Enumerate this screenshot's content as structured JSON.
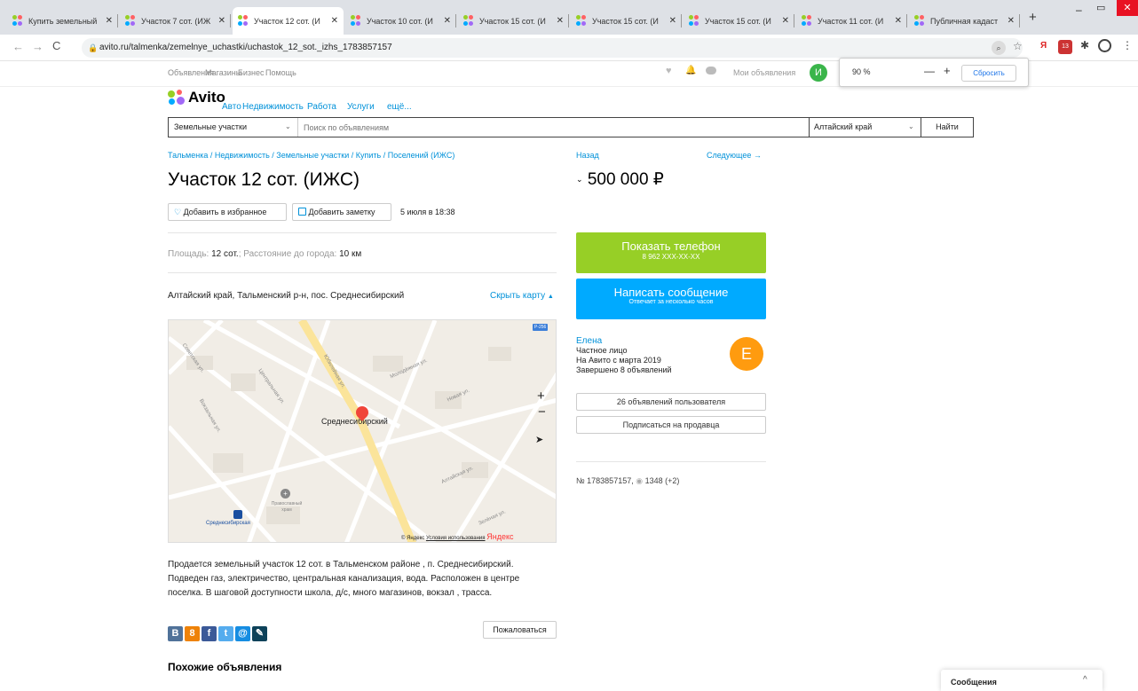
{
  "browser": {
    "tabs": [
      {
        "title": "Купить земельный",
        "active": false
      },
      {
        "title": "Участок 7 сот. (ИЖ",
        "active": false
      },
      {
        "title": "Участок 12 сот. (И",
        "active": true
      },
      {
        "title": "Участок 10 сот. (И",
        "active": false
      },
      {
        "title": "Участок 15 сот. (И",
        "active": false
      },
      {
        "title": "Участок 15 сот. (И",
        "active": false
      },
      {
        "title": "Участок 15 сот. (И",
        "active": false
      },
      {
        "title": "Участок 11 сот. (И",
        "active": false
      },
      {
        "title": "Публичная кадаст",
        "active": false
      }
    ],
    "new_tab": "+",
    "url": "avito.ru/talmenka/zemelnye_uchastki/uchastok_12_sot._izhs_1783857157",
    "zoom": {
      "value": "90 %",
      "minus": "—",
      "plus": "+",
      "reset": "Сбросить"
    }
  },
  "site_top": {
    "links": [
      "Объявления",
      "Магазины",
      "Бизнес",
      "Помощь"
    ],
    "my_ads": "Мои объявления",
    "avatar_letter": "И"
  },
  "header": {
    "logo": "Avito",
    "nav": [
      "Авто",
      "Недвижимость",
      "Работа",
      "Услуги",
      "ещё..."
    ]
  },
  "search": {
    "category": "Земельные участки",
    "placeholder": "Поиск по объявлениям",
    "region": "Алтайский край",
    "submit": "Найти"
  },
  "breadcrumb": "Тальменка / Недвижимость / Земельные участки / Купить / Поселений (ИЖС)",
  "listing": {
    "title": "Участок 12 сот. (ИЖС)",
    "fav_button": "Добавить в избранное",
    "note_button": "Добавить заметку",
    "date": "5 июля в 18:38",
    "area_label": "Площадь:",
    "area_value": "12 сот.",
    "distance_label": "Расстояние до города:",
    "distance_value": "10 км",
    "address": "Алтайский край, Тальменский р-н, пос. Среднесибирский",
    "hide_map": "Скрыть карту",
    "description": [
      "Продается земельный участок 12 сот. в Тальменском районе , п. Среднесибирский.",
      "Подведен газ, электричество, центральная канализация, вода. Расположен в центре",
      "поселка. В шаговой доступности школа, д/с, много магазинов, вокзал , трасса."
    ],
    "report": "Пожаловаться",
    "similar_title": "Похожие объявления"
  },
  "map": {
    "place_label": "Среднесибирский",
    "station_label": "Среднесибирская",
    "church_label": "Православный храм",
    "road_badge": "Р-256",
    "streets": [
      "Молодёжная ул.",
      "Юбилейная ул.",
      "Центральная ул.",
      "Советская ул.",
      "Вокзальная ул.",
      "Новая ул.",
      "Алтайская ул.",
      "Зелёная ул."
    ],
    "zoom_in": "+",
    "zoom_out": "−",
    "copyright": "© Яндекс",
    "terms": "Условия использования",
    "brand": "Яндекс"
  },
  "sidebar": {
    "back": "Назад",
    "next": "Следующее →",
    "price": "500 000 ₽",
    "show_phone": "Показать телефон",
    "phone_masked": "8 962 XXX-XX-XX",
    "write_message": "Написать сообщение",
    "reply_time": "Отвечает за несколько часов",
    "seller_name": "Елена",
    "seller_type": "Частное лицо",
    "seller_since": "На Авито с марта 2019",
    "seller_done": "Завершено 8 объявлений",
    "seller_letter": "Е",
    "user_ads_button": "26 объявлений пользователя",
    "subscribe_button": "Подписаться на продавца",
    "ad_number": "№ 1783857157,",
    "views": "1348 (+2)"
  },
  "messages_widget": {
    "title": "Сообщения"
  },
  "colors": {
    "green": "#97cf26",
    "blue": "#00aaff",
    "link": "#0091d9",
    "orange": "#ff9b0f",
    "avatar_green": "#3ab54a"
  }
}
